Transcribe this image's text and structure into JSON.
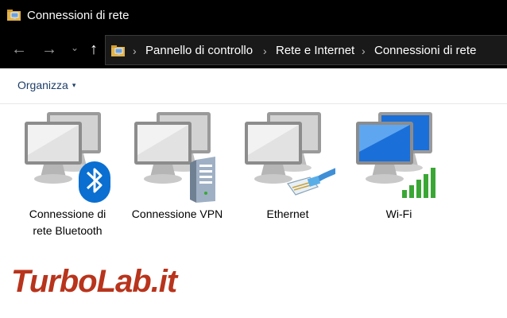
{
  "window": {
    "title": "Connessioni di rete",
    "icon": "network-folder-icon"
  },
  "nav": {
    "back_icon": "back-arrow-icon",
    "forward_icon": "forward-arrow-icon",
    "recent_icon": "chevron-down-icon",
    "up_icon": "up-arrow-icon",
    "back_glyph": "←",
    "forward_glyph": "→",
    "recent_glyph": "⌄",
    "up_glyph": "↑",
    "separator": "›"
  },
  "address_bar": {
    "icon": "network-folder-icon",
    "breadcrumbs": [
      "Pannello di controllo",
      "Rete e Internet",
      "Connessioni di rete"
    ]
  },
  "toolbar": {
    "organize_label": "Organizza",
    "organize_caret": "▾"
  },
  "connections": [
    {
      "label": "Connessione di\nrete Bluetooth",
      "overlay_icon": "bluetooth-icon"
    },
    {
      "label": "Connessione VPN",
      "overlay_icon": "server-icon"
    },
    {
      "label": "Ethernet",
      "overlay_icon": "ethernet-cable-icon"
    },
    {
      "label": "Wi-Fi",
      "overlay_icon": "wifi-signal-bars-icon"
    }
  ],
  "watermark": {
    "text": "TurboLab.it"
  },
  "colors": {
    "titlebar_bg": "#000000",
    "address_bg": "#191919",
    "organize_text": "#1e3f6a",
    "bluetooth_blue": "#0a6fd1",
    "wifi_green": "#3aa735",
    "monitor_blue": "#1b6fd8",
    "watermark_red": "#b8341c"
  }
}
